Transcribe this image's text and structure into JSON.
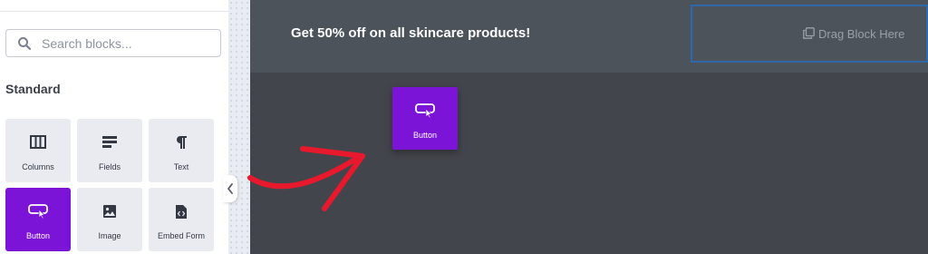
{
  "sidebar": {
    "search": {
      "placeholder": "Search blocks..."
    },
    "section_title": "Standard",
    "blocks": [
      {
        "label": "Columns",
        "icon": "columns-icon"
      },
      {
        "label": "Fields",
        "icon": "fields-icon"
      },
      {
        "label": "Text",
        "icon": "paragraph-icon"
      },
      {
        "label": "Button",
        "icon": "button-icon",
        "selected": true
      },
      {
        "label": "Image",
        "icon": "image-icon"
      },
      {
        "label": "Embed Form",
        "icon": "embed-form-icon"
      }
    ]
  },
  "canvas": {
    "banner_text": "Get 50% off on all skincare products!",
    "dropzone_label": "Drag Block Here",
    "dragged_block_label": "Button"
  },
  "colors": {
    "accent": "#7c14d8",
    "canvas_bg": "#43454c",
    "banner_bg": "#4c535a",
    "dropzone_border": "#2f67a8",
    "arrow": "#e8192c"
  }
}
